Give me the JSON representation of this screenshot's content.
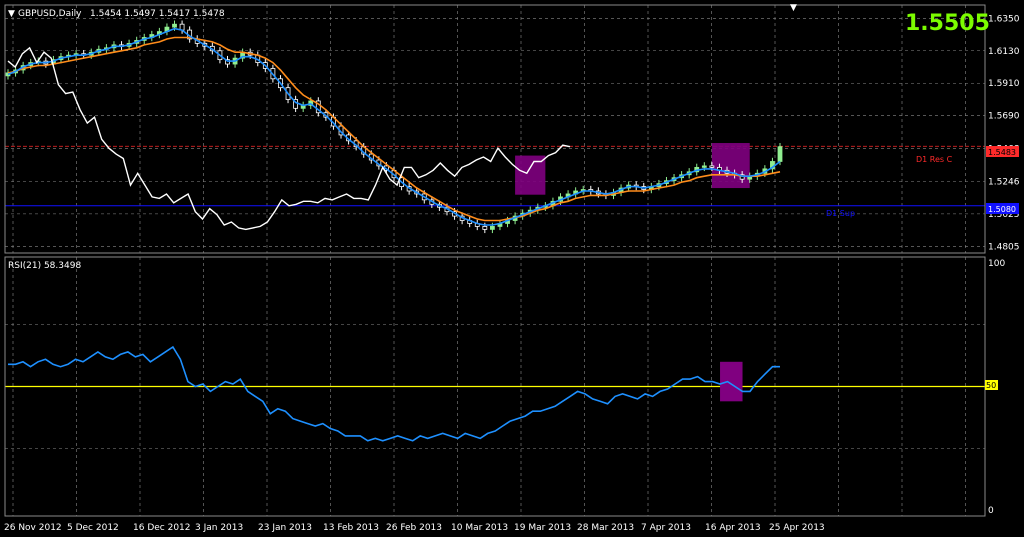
{
  "header": {
    "symbol": "GBPUSD,Daily",
    "ohlc": "1.5454 1.5497 1.5417 1.5478",
    "current_price": "1.5505"
  },
  "colors": {
    "background": "#000000",
    "grid": "#8a8a8a",
    "bull_candle": "#90ee90",
    "bear_candle": "#ffffff",
    "ma_fast": "#1e90ff",
    "ma_slow": "#ff8c1a",
    "overlay": "#ffffff",
    "resistance": "#ff2a2a",
    "support": "#1010ff",
    "rsi": "#1e90ff",
    "rsi_level": "#ffff00",
    "highlight": "#800080",
    "current_price_text": "#7cfc00"
  },
  "levels": {
    "resistance_label": "D1 Res C",
    "support_label": "D1 Sup",
    "resistance_value": "1.5483",
    "support_value": "1.5080"
  },
  "rsi_panel": {
    "title": "RSI(21) 58.3498",
    "level_label": "50",
    "max_label": "100",
    "min_label": "0"
  },
  "chart_data": [
    {
      "type": "candlestick",
      "title": "GBPUSD,Daily",
      "y_ticks": [
        "1.6350",
        "1.6130",
        "1.5910",
        "1.5690",
        "1.5468",
        "1.5246",
        "1.5025",
        "1.4805"
      ],
      "ylim": [
        1.476,
        1.644
      ],
      "x_ticks": [
        "26 Nov 2012",
        "5 Dec 2012",
        "16 Dec 2012",
        "3 Jan 2013",
        "23 Jan 2013",
        "13 Feb 2013",
        "26 Feb 2013",
        "10 Mar 2013",
        "19 Mar 2013",
        "28 Mar 2013",
        "7 Apr 2013",
        "16 Apr 2013",
        "25 Apr 2013"
      ],
      "grid": true,
      "close": [
        1.598,
        1.6,
        1.603,
        1.605,
        1.606,
        1.604,
        1.607,
        1.609,
        1.61,
        1.611,
        1.61,
        1.612,
        1.614,
        1.615,
        1.617,
        1.616,
        1.618,
        1.62,
        1.622,
        1.624,
        1.626,
        1.629,
        1.631,
        1.627,
        1.621,
        1.618,
        1.616,
        1.613,
        1.607,
        1.604,
        1.608,
        1.612,
        1.61,
        1.605,
        1.601,
        1.594,
        1.588,
        1.58,
        1.574,
        1.576,
        1.579,
        1.571,
        1.568,
        1.562,
        1.556,
        1.552,
        1.548,
        1.543,
        1.539,
        1.535,
        1.532,
        1.527,
        1.521,
        1.518,
        1.516,
        1.512,
        1.509,
        1.507,
        1.504,
        1.501,
        1.498,
        1.496,
        1.494,
        1.492,
        1.494,
        1.496,
        1.498,
        1.501,
        1.503,
        1.505,
        1.507,
        1.508,
        1.511,
        1.514,
        1.516,
        1.518,
        1.519,
        1.518,
        1.516,
        1.515,
        1.517,
        1.52,
        1.522,
        1.521,
        1.519,
        1.521,
        1.523,
        1.525,
        1.527,
        1.529,
        1.531,
        1.534,
        1.535,
        1.534,
        1.532,
        1.53,
        1.529,
        1.526,
        1.528,
        1.53,
        1.533,
        1.538,
        1.548
      ],
      "series": [
        {
          "name": "",
          "color": "#1e90ff",
          "values": [
            1.597,
            1.599,
            1.602,
            1.604,
            1.605,
            1.605,
            1.606,
            1.608,
            1.609,
            1.61,
            1.61,
            1.611,
            1.613,
            1.614,
            1.616,
            1.616,
            1.617,
            1.619,
            1.621,
            1.622,
            1.624,
            1.626,
            1.628,
            1.627,
            1.623,
            1.62,
            1.617,
            1.614,
            1.61,
            1.606,
            1.606,
            1.609,
            1.609,
            1.607,
            1.603,
            1.597,
            1.591,
            1.584,
            1.578,
            1.576,
            1.577,
            1.573,
            1.569,
            1.564,
            1.558,
            1.553,
            1.549,
            1.544,
            1.54,
            1.536,
            1.533,
            1.529,
            1.524,
            1.52,
            1.517,
            1.514,
            1.511,
            1.508,
            1.506,
            1.503,
            1.5,
            1.498,
            1.496,
            1.495,
            1.495,
            1.496,
            1.498,
            1.5,
            1.502,
            1.504,
            1.506,
            1.508,
            1.51,
            1.512,
            1.514,
            1.516,
            1.518,
            1.518,
            1.517,
            1.516,
            1.517,
            1.519,
            1.521,
            1.521,
            1.52,
            1.521,
            1.522,
            1.524,
            1.526,
            1.528,
            1.53,
            1.532,
            1.533,
            1.533,
            1.532,
            1.531,
            1.53,
            1.528,
            1.528,
            1.529,
            1.531,
            1.534,
            1.538
          ]
        },
        {
          "name": "",
          "color": "#ff8c1a",
          "values": [
            1.598,
            1.599,
            1.601,
            1.602,
            1.603,
            1.603,
            1.604,
            1.605,
            1.606,
            1.607,
            1.608,
            1.609,
            1.61,
            1.611,
            1.612,
            1.613,
            1.614,
            1.615,
            1.617,
            1.618,
            1.619,
            1.621,
            1.622,
            1.622,
            1.622,
            1.621,
            1.62,
            1.619,
            1.617,
            1.614,
            1.612,
            1.612,
            1.611,
            1.61,
            1.608,
            1.605,
            1.6,
            1.594,
            1.588,
            1.583,
            1.58,
            1.577,
            1.573,
            1.568,
            1.563,
            1.558,
            1.553,
            1.548,
            1.544,
            1.54,
            1.536,
            1.532,
            1.528,
            1.524,
            1.52,
            1.517,
            1.514,
            1.511,
            1.508,
            1.505,
            1.503,
            1.501,
            1.499,
            1.498,
            1.498,
            1.498,
            1.499,
            1.5,
            1.501,
            1.503,
            1.505,
            1.506,
            1.508,
            1.51,
            1.511,
            1.513,
            1.514,
            1.515,
            1.515,
            1.515,
            1.516,
            1.517,
            1.518,
            1.518,
            1.518,
            1.519,
            1.52,
            1.521,
            1.522,
            1.524,
            1.525,
            1.527,
            1.528,
            1.529,
            1.529,
            1.529,
            1.529,
            1.528,
            1.528,
            1.528,
            1.529,
            1.53,
            1.531
          ]
        },
        {
          "name": "",
          "color": "#ffffff",
          "values": [
            1.606,
            1.602,
            1.611,
            1.615,
            1.605,
            1.612,
            1.608,
            1.59,
            1.584,
            1.585,
            1.573,
            1.564,
            1.568,
            1.553,
            1.547,
            1.543,
            1.54,
            1.522,
            1.53,
            1.522,
            1.514,
            1.513,
            1.516,
            1.51,
            1.513,
            1.516,
            1.504,
            1.499,
            1.506,
            1.502,
            1.495,
            1.497,
            1.493,
            1.492,
            1.493,
            1.494,
            1.497,
            1.504,
            1.512,
            1.508,
            1.509,
            1.511,
            1.511,
            1.51,
            1.513,
            1.512,
            1.514,
            1.516,
            1.513,
            1.513,
            1.512,
            1.522,
            1.534,
            1.526,
            1.522,
            1.534,
            1.534,
            1.527,
            1.529,
            1.532,
            1.537,
            1.532,
            1.528,
            1.534,
            1.536,
            1.539,
            1.541,
            1.538,
            1.547,
            1.541,
            1.536,
            1.532,
            1.53,
            1.538,
            1.538,
            1.542,
            1.544,
            1.549,
            1.548
          ]
        }
      ]
    },
    {
      "type": "line",
      "title": "RSI(21) 58.3498",
      "ylim": [
        0,
        100
      ],
      "level": 50,
      "y_ticks": [
        "100",
        "50",
        "0"
      ],
      "series": [
        {
          "name": "",
          "color": "#1e90ff",
          "values": [
            59,
            59,
            60,
            58,
            60,
            61,
            59,
            58,
            59,
            61,
            60,
            62,
            64,
            62,
            61,
            63,
            64,
            62,
            63,
            60,
            62,
            64,
            66,
            61,
            52,
            50,
            51,
            48,
            50,
            52,
            51,
            53,
            48,
            46,
            44,
            39,
            41,
            40,
            37,
            36,
            35,
            34,
            35,
            33,
            32,
            30,
            30,
            30,
            28,
            29,
            28,
            29,
            30,
            29,
            28,
            30,
            29,
            30,
            31,
            30,
            29,
            31,
            30,
            29,
            31,
            32,
            34,
            36,
            37,
            38,
            40,
            40,
            41,
            42,
            44,
            46,
            48,
            47,
            45,
            44,
            43,
            46,
            47,
            46,
            45,
            47,
            46,
            48,
            49,
            51,
            53,
            53,
            54,
            52,
            52,
            51,
            52,
            50,
            48,
            48,
            52,
            55,
            58,
            58
          ]
        }
      ]
    }
  ]
}
